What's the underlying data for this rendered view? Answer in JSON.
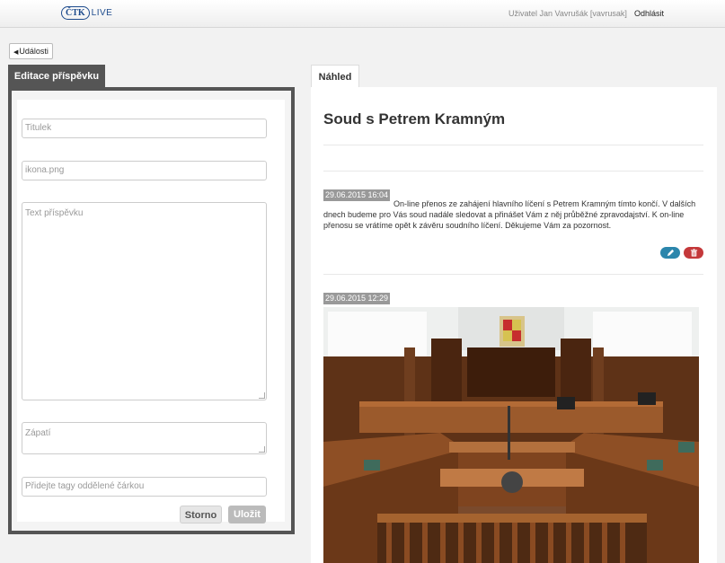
{
  "header": {
    "logo_ctk": "ČTK",
    "logo_live": "LIVE",
    "user": "Uživatel Jan Vavrušák [vavrusak]",
    "logout": "Odhlásit"
  },
  "back_button": "Události",
  "editor": {
    "tab": "Editace příspěvku",
    "title_placeholder": "Titulek",
    "icon_value": "ikona.png",
    "text_placeholder": "Text příspěvku",
    "footer_placeholder": "Zápatí",
    "tags_placeholder": "Přidejte tagy oddělené čárkou",
    "cancel": "Storno",
    "save": "Uložit"
  },
  "preview": {
    "tab": "Náhled",
    "title": "Soud s Petrem Kramným",
    "posts": [
      {
        "timestamp": "29.06.2015 16:04",
        "text": "On-line přenos ze zahájení hlavního líčení s Petrem Kramným tímto končí. V dalších dnech budeme pro Vás soud nadále sledovat a přinášet Vám z něj průběžné zpravodajství. K on-line přenosu se vrátíme opět k závěru soudního líčení. Děkujeme Vám za pozornost."
      },
      {
        "timestamp": "29.06.2015 12:29"
      }
    ],
    "edit_icon": "pencil-icon",
    "delete_icon": "trash-icon"
  }
}
